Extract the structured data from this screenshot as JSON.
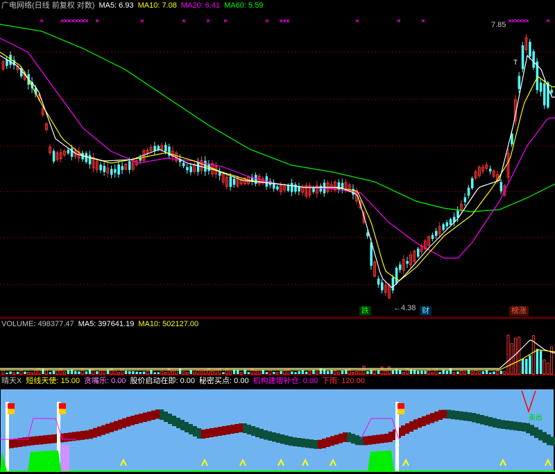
{
  "main_legend": {
    "title": "广电网络(日线 前复权 对数)",
    "ma5": "MA5: 6.93",
    "ma10": "MA10: 7.08",
    "ma20": "MA20: 6.41",
    "ma60": "MA60: 5.59"
  },
  "annotations": {
    "high_price": "7.85",
    "low_price": "←4.38",
    "tag_die": "跌",
    "tag_cai": "财",
    "tag_bangzhang": "榜涨",
    "tag_T": "T"
  },
  "volume_legend": {
    "volume": "VOLUME: 498377.47",
    "ma5": "MA5: 397641.19",
    "ma10": "MA10: 502127.00"
  },
  "indicator_legend": {
    "name": "晴天X",
    "short_term": "短线天使: 15.00",
    "greedy": "贪嘴乐: 0.00",
    "launch": "股价启动在即: 0.00",
    "secret_buy": "秘密买点: 0.00",
    "institution": "机构建增补仓: 0.00",
    "rain": "下雨: 120.00",
    "sign_label": "卖出"
  },
  "colors": {
    "up": "#ff3232",
    "down": "#54ffff",
    "ma5": "#ffffff",
    "ma10": "#ffff00",
    "ma20": "#ff00ff",
    "ma60": "#00ff00",
    "grid": "#8b0000",
    "indicator_bg": "#6fb4f0"
  }
}
